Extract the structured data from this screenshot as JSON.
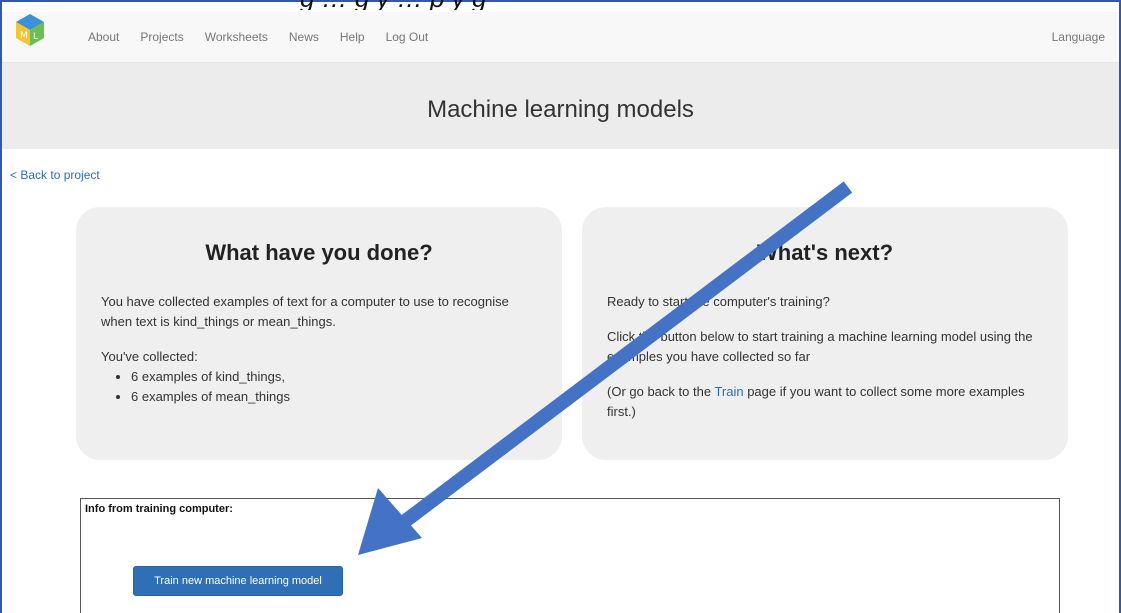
{
  "banner_text": "g … g y … p y g",
  "nav": {
    "items": [
      "About",
      "Projects",
      "Worksheets",
      "News",
      "Help",
      "Log Out"
    ],
    "language": "Language"
  },
  "hero": {
    "title": "Machine learning models"
  },
  "back_link": "< Back to project",
  "left_card": {
    "title": "What have you done?",
    "para1": "You have collected examples of text for a computer to use to recognise when text is kind_things or mean_things.",
    "collected_label": "You've collected:",
    "items": [
      "6 examples of kind_things,",
      "6 examples of mean_things"
    ]
  },
  "right_card": {
    "title": "What's next?",
    "para1": "Ready to start the computer's training?",
    "para2": "Click the button below to start training a machine learning model using the examples you have collected so far",
    "para3_before": "(Or go back to the ",
    "para3_link": "Train",
    "para3_after": " page if you want to collect some more examples first.)"
  },
  "info_box": {
    "label": "Info from training computer:",
    "button_label": "Train new machine learning model"
  },
  "colors": {
    "accent": "#2f6fb5",
    "arrow": "#4472c4"
  },
  "icons": {
    "logo": "ml-cube-logo-icon",
    "arrow": "annotation-arrow-icon"
  }
}
